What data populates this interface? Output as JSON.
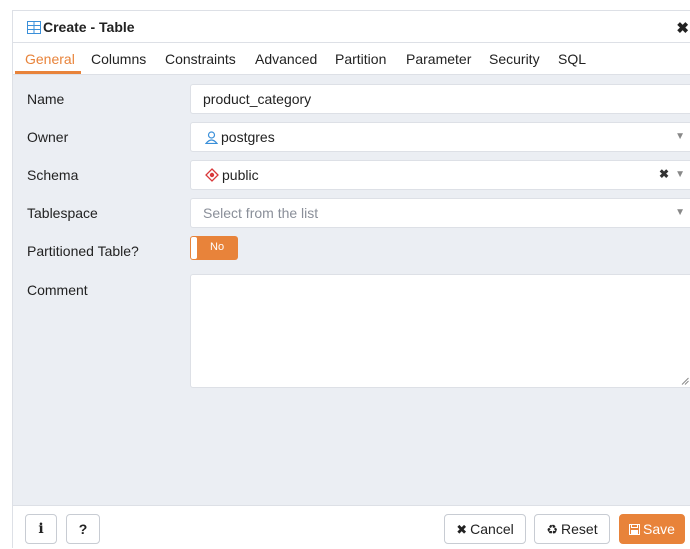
{
  "dialog": {
    "title": "Create - Table",
    "close_icon": "✖"
  },
  "tabs": [
    "General",
    "Columns",
    "Constraints",
    "Advanced",
    "Partition",
    "Parameter",
    "Security",
    "SQL"
  ],
  "active_tab": "General",
  "form": {
    "name_label": "Name",
    "name_value": "product_category",
    "owner_label": "Owner",
    "owner_value": "postgres",
    "schema_label": "Schema",
    "schema_value": "public",
    "tablespace_label": "Tablespace",
    "tablespace_placeholder": "Select from the list",
    "partitioned_label": "Partitioned Table?",
    "partitioned_value": "No",
    "comment_label": "Comment",
    "comment_value": ""
  },
  "footer": {
    "info_label": "i",
    "help_label": "?",
    "cancel_label": "Cancel",
    "reset_label": "Reset",
    "save_label": "Save"
  },
  "colors": {
    "accent": "#e8833a",
    "background": "#ebeef3"
  }
}
